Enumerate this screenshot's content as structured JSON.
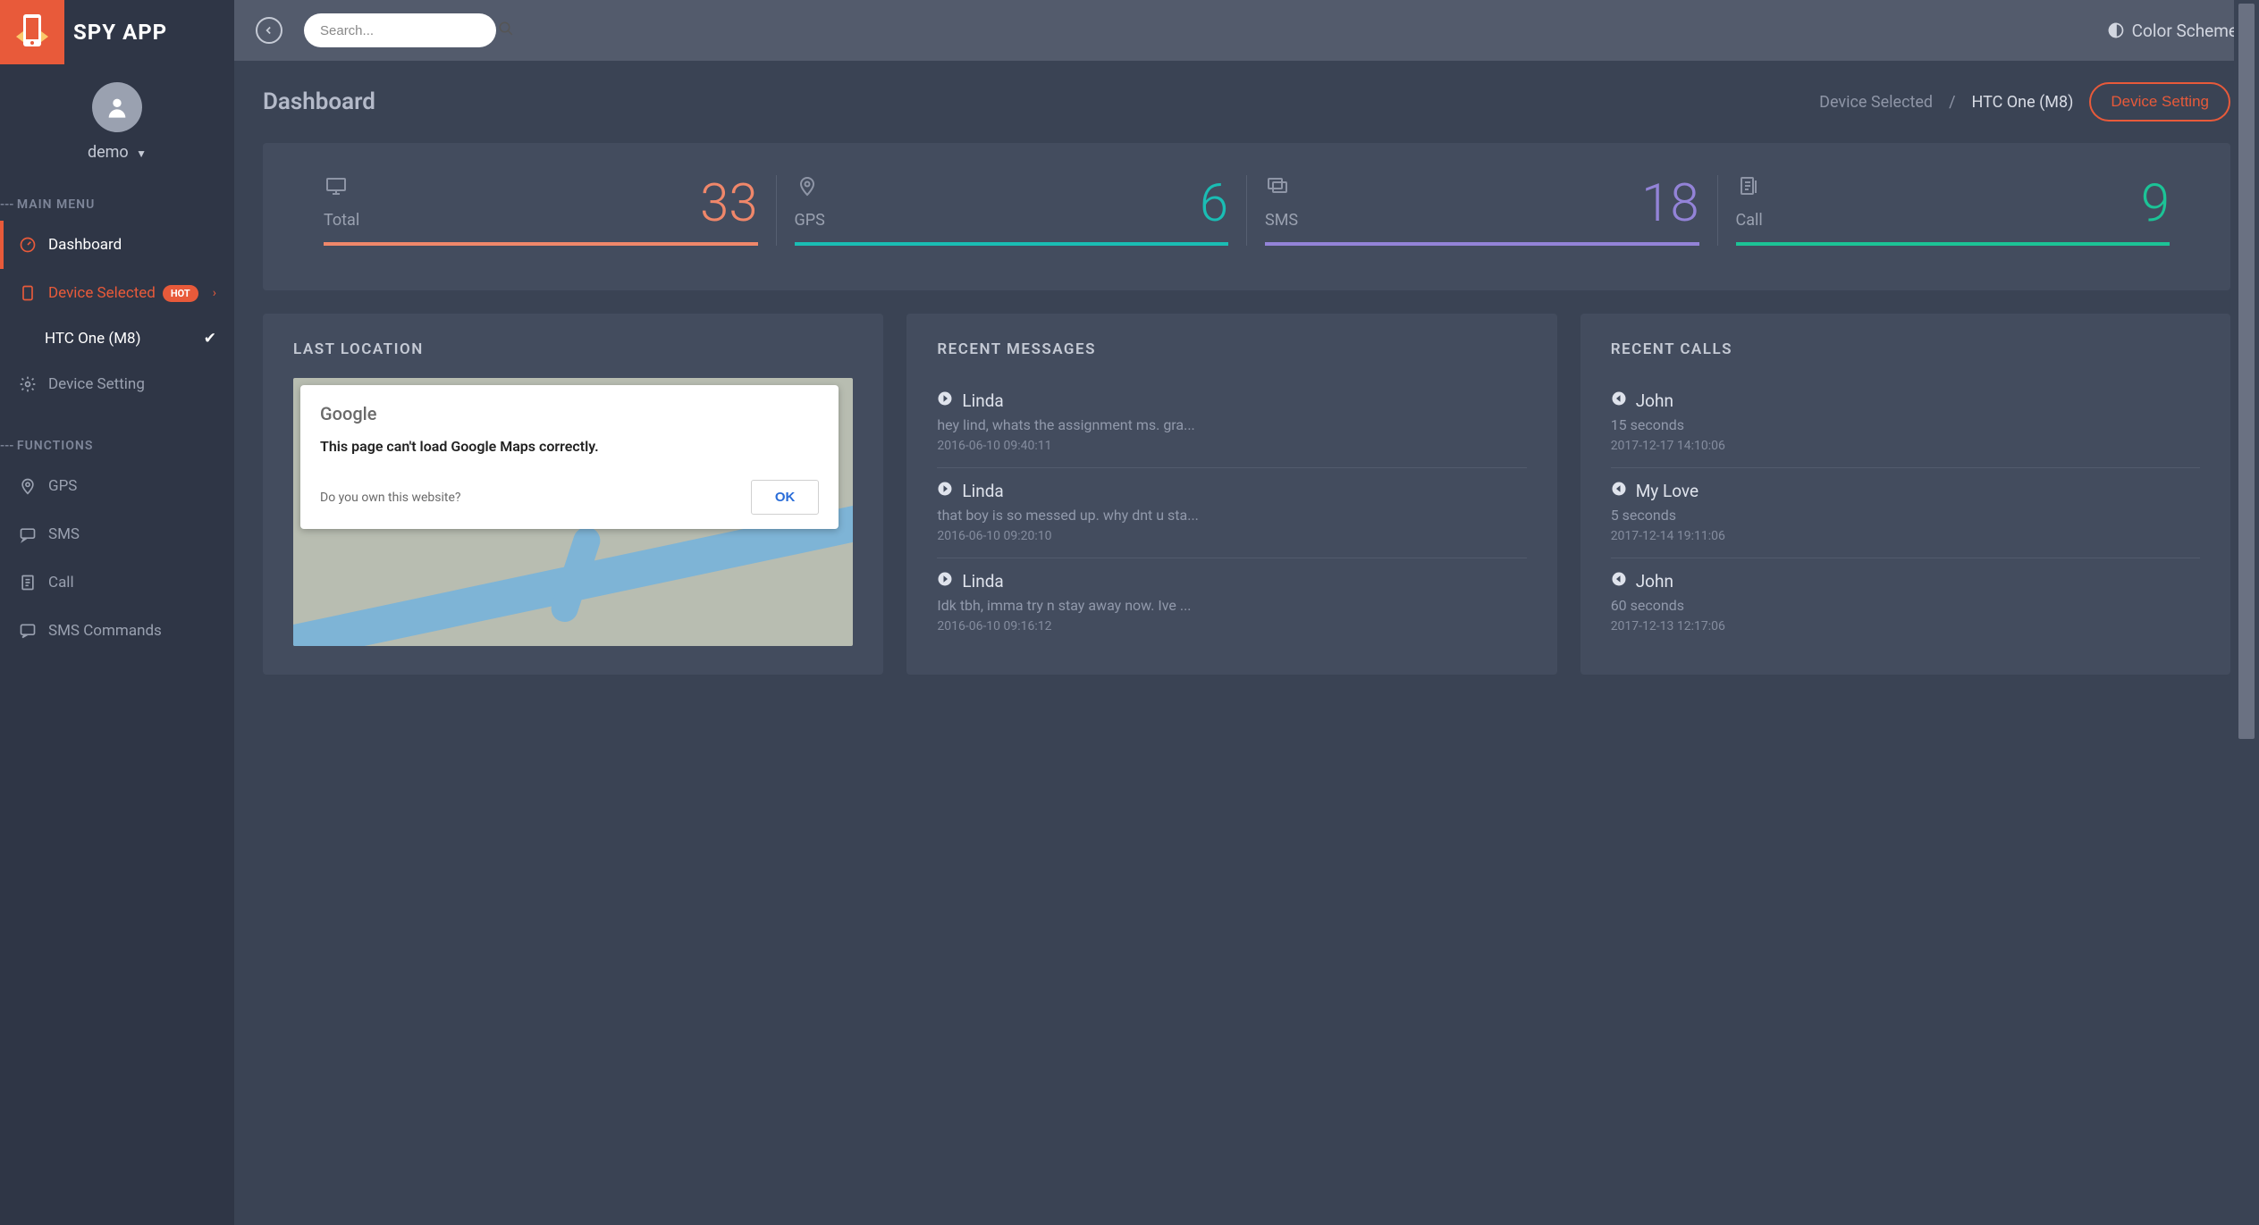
{
  "brand": "SPY APP",
  "user": {
    "name": "demo"
  },
  "search": {
    "placeholder": "Search..."
  },
  "color_scheme_label": "Color Scheme",
  "sidebar": {
    "section_main": "MAIN MENU",
    "section_functions": "FUNCTIONS",
    "dashboard": "Dashboard",
    "device_selected": "Device Selected",
    "hot_badge": "HOT",
    "selected_device": "HTC One (M8)",
    "device_setting": "Device Setting",
    "gps": "GPS",
    "sms": "SMS",
    "call": "Call",
    "sms_commands": "SMS Commands"
  },
  "header": {
    "title": "Dashboard",
    "breadcrumb_label": "Device Selected",
    "breadcrumb_device": "HTC One (M8)",
    "device_setting_btn": "Device Setting"
  },
  "stats": {
    "total": {
      "label": "Total",
      "value": "33"
    },
    "gps": {
      "label": "GPS",
      "value": "6"
    },
    "sms": {
      "label": "SMS",
      "value": "18"
    },
    "call": {
      "label": "Call",
      "value": "9"
    }
  },
  "panels": {
    "last_location": "LAST LOCATION",
    "recent_messages": "RECENT MESSAGES",
    "recent_calls": "RECENT CALLS"
  },
  "map_dialog": {
    "logo": "Google",
    "error": "This page can't load Google Maps correctly.",
    "question": "Do you own this website?",
    "ok": "OK"
  },
  "messages": [
    {
      "name": "Linda",
      "text": "hey lind, whats the assignment ms. gra...",
      "time": "2016-06-10 09:40:11"
    },
    {
      "name": "Linda",
      "text": "that boy is so messed up. why dnt u sta...",
      "time": "2016-06-10 09:20:10"
    },
    {
      "name": "Linda",
      "text": "Idk tbh, imma try n stay away now. Ive ...",
      "time": "2016-06-10 09:16:12"
    }
  ],
  "calls": [
    {
      "name": "John",
      "duration": "15 seconds",
      "time": "2017-12-17 14:10:06"
    },
    {
      "name": "My Love",
      "duration": "5 seconds",
      "time": "2017-12-14 19:11:06"
    },
    {
      "name": "John",
      "duration": "60 seconds",
      "time": "2017-12-13 12:17:06"
    }
  ]
}
